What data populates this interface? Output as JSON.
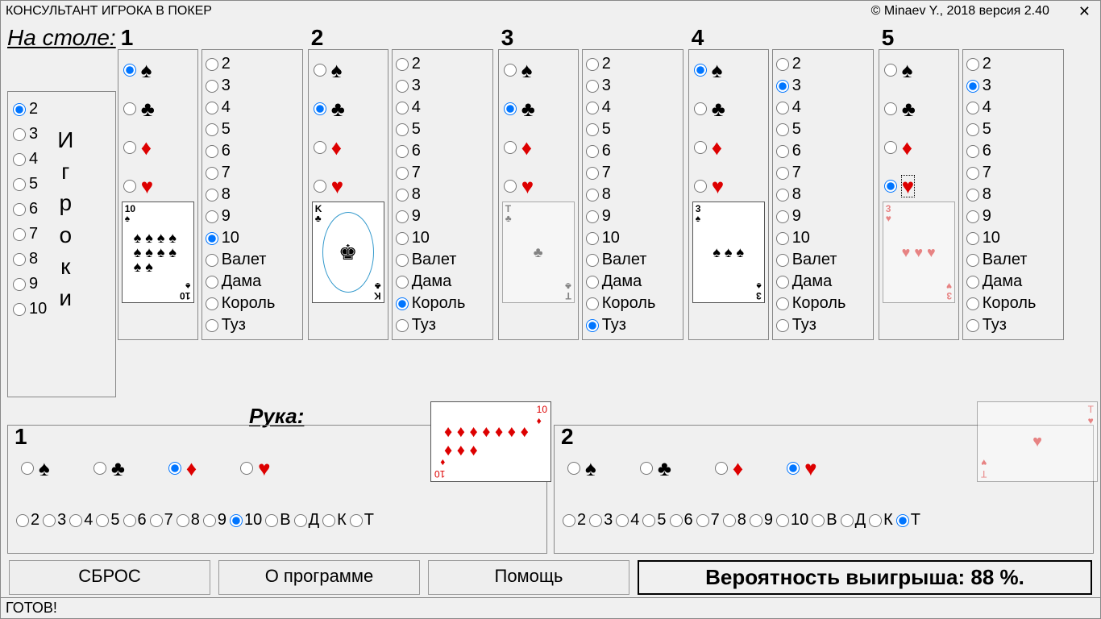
{
  "title_left": "КОНСУЛЬТАНТ ИГРОКА В ПОКЕР",
  "title_right": "© Minaev Y., 2018 версия 2.40",
  "board_label": "На столе:",
  "players_label_chars": [
    "И",
    "г",
    "р",
    "о",
    "к",
    "и"
  ],
  "players_options": [
    "2",
    "3",
    "4",
    "5",
    "6",
    "7",
    "8",
    "9",
    "10"
  ],
  "players_selected": "2",
  "suits": [
    {
      "id": "spade",
      "glyph": "♠",
      "cls": "black"
    },
    {
      "id": "club",
      "glyph": "♣",
      "cls": "black"
    },
    {
      "id": "diamond",
      "glyph": "♦",
      "cls": "red"
    },
    {
      "id": "heart",
      "glyph": "♥",
      "cls": "red"
    }
  ],
  "rank_labels": [
    "2",
    "3",
    "4",
    "5",
    "6",
    "7",
    "8",
    "9",
    "10",
    "Валет",
    "Дама",
    "Король",
    "Туз"
  ],
  "board_slots": [
    {
      "num": "1",
      "suit_sel": "spade",
      "rank_sel": "10",
      "card": {
        "rank": "10",
        "suit": "spade",
        "pips": 10,
        "cls": "black"
      }
    },
    {
      "num": "2",
      "suit_sel": "club",
      "rank_sel": "Король",
      "card": {
        "rank": "K",
        "suit": "club",
        "face": "king",
        "cls": "black"
      }
    },
    {
      "num": "3",
      "suit_sel": "club",
      "rank_sel": "Туз",
      "card": {
        "rank": "T",
        "suit": "club",
        "pips": 1,
        "cls": "black",
        "faded": true
      }
    },
    {
      "num": "4",
      "suit_sel": "spade",
      "rank_sel": "3",
      "card": {
        "rank": "3",
        "suit": "spade",
        "pips": 3,
        "cls": "black"
      }
    },
    {
      "num": "5",
      "suit_sel": "heart",
      "rank_sel": "3",
      "card": {
        "rank": "3",
        "suit": "heart",
        "pips": 3,
        "cls": "red",
        "faded": true
      },
      "focus": true
    }
  ],
  "hand_label": "Рука:",
  "hand_rank_short": [
    "2",
    "3",
    "4",
    "5",
    "6",
    "7",
    "8",
    "9",
    "10",
    "В",
    "Д",
    "К",
    "Т"
  ],
  "hand_slots": [
    {
      "num": "1",
      "suit_sel": "diamond",
      "rank_sel": "10",
      "card": {
        "rank": "10",
        "suit": "diamond",
        "pips": 10,
        "cls": "red",
        "wide": true
      }
    },
    {
      "num": "2",
      "suit_sel": "heart",
      "rank_sel": "Т",
      "card": {
        "rank": "T",
        "suit": "heart",
        "pips": 1,
        "cls": "red",
        "wide": true,
        "faded": true
      }
    }
  ],
  "buttons": {
    "reset": "СБРОС",
    "about": "О программе",
    "help": "Помощь"
  },
  "prob_label": "Вероятность выигрыша: 88 %.",
  "status": "ГОТОВ!"
}
